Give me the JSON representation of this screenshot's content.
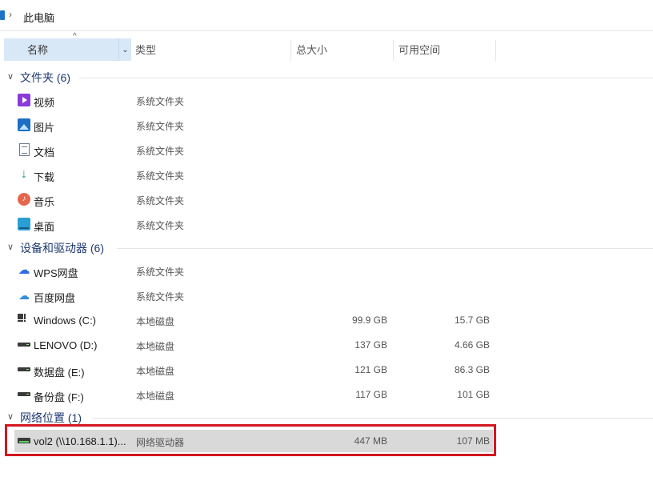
{
  "address": {
    "location": "此电脑"
  },
  "columns": {
    "name": "名称",
    "type": "类型",
    "total": "总大小",
    "free": "可用空间"
  },
  "groups": [
    {
      "title": "文件夹 (6)",
      "items": [
        {
          "name": "视频",
          "type": "系统文件夹",
          "icon": "video-icon"
        },
        {
          "name": "图片",
          "type": "系统文件夹",
          "icon": "pictures-icon"
        },
        {
          "name": "文档",
          "type": "系统文件夹",
          "icon": "documents-icon"
        },
        {
          "name": "下载",
          "type": "系统文件夹",
          "icon": "download-icon"
        },
        {
          "name": "音乐",
          "type": "系统文件夹",
          "icon": "music-icon"
        },
        {
          "name": "桌面",
          "type": "系统文件夹",
          "icon": "desktop-icon"
        }
      ]
    },
    {
      "title": "设备和驱动器 (6)",
      "items": [
        {
          "name": "WPS网盘",
          "type": "系统文件夹",
          "icon": "cloud-icon"
        },
        {
          "name": "百度网盘",
          "type": "系统文件夹",
          "icon": "baidu-cloud-icon"
        },
        {
          "name": "Windows (C:)",
          "type": "本地磁盘",
          "total": "99.9 GB",
          "free": "15.7 GB",
          "icon": "windows-drive-icon"
        },
        {
          "name": "LENOVO (D:)",
          "type": "本地磁盘",
          "total": "137 GB",
          "free": "4.66 GB",
          "icon": "drive-icon"
        },
        {
          "name": "数据盘 (E:)",
          "type": "本地磁盘",
          "total": "121 GB",
          "free": "86.3 GB",
          "icon": "drive-icon"
        },
        {
          "name": "备份盘 (F:)",
          "type": "本地磁盘",
          "total": "117 GB",
          "free": "101 GB",
          "icon": "drive-icon"
        }
      ]
    },
    {
      "title": "网络位置 (1)",
      "items": [
        {
          "name": "vol2 (\\\\10.168.1.1)...",
          "type": "网络驱动器",
          "total": "447 MB",
          "free": "107 MB",
          "icon": "network-drive-icon"
        }
      ]
    }
  ],
  "colors": {
    "highlight": "#d4161f",
    "selected_row": "#d9d9d9",
    "header_active": "#d9e8f7"
  }
}
